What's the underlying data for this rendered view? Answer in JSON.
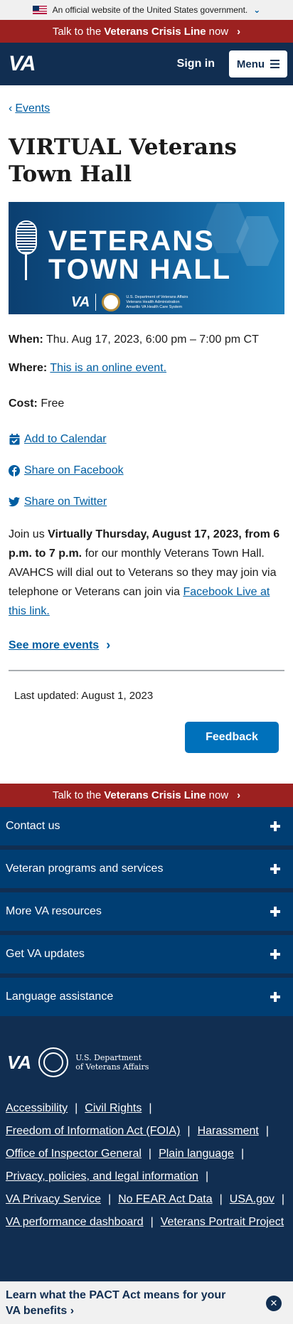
{
  "gov_banner": {
    "text": "An official website of the United States government."
  },
  "crisis": {
    "prefix": "Talk to the ",
    "bold": "Veterans Crisis Line",
    "suffix": " now"
  },
  "header": {
    "logo": "VA",
    "sign_in": "Sign in",
    "menu": "Menu"
  },
  "breadcrumb": {
    "label": "Events"
  },
  "page_title": "VIRTUAL Veterans Town Hall",
  "hero": {
    "line1": "VETERANS",
    "line2": "TOWN HALL",
    "va": "VA",
    "dept1": "U.S. Department of Veterans Affairs",
    "dept2": "Veterans Health Administration",
    "dept3": "Amarillo VA Health Care System"
  },
  "event": {
    "when_label": "When:",
    "when_value": "Thu. Aug 17, 2023, 6:00 pm – 7:00 pm CT",
    "where_label": "Where:",
    "where_value": "This is an online event.",
    "cost_label": "Cost:",
    "cost_value": "Free",
    "add_calendar": "Add to Calendar",
    "share_facebook": "Share on Facebook",
    "share_twitter": "Share on Twitter"
  },
  "description": {
    "p1": "Join us ",
    "bold": "Virtually Thursday, August 17, 2023, from 6 p.m. to 7 p.m.",
    "p2": " for our monthly Veterans Town Hall. AVAHCS will dial out to Veterans so they may join via telephone or Veterans can join via ",
    "link": "Facebook Live at this link."
  },
  "see_more": "See more events",
  "last_updated": "Last updated: August 1, 2023",
  "feedback": "Feedback",
  "footer": {
    "accordion": [
      {
        "label": "Contact us"
      },
      {
        "label": "Veteran programs and services"
      },
      {
        "label": "More VA resources"
      },
      {
        "label": "Get VA updates"
      },
      {
        "label": "Language assistance"
      }
    ],
    "logo_va": "VA",
    "dept_line1": "U.S. Department",
    "dept_line2": "of Veterans Affairs",
    "links": {
      "accessibility": "Accessibility",
      "civil_rights": "Civil Rights",
      "foia": "Freedom of Information Act (FOIA)",
      "harassment": "Harassment",
      "oig": "Office of Inspector General",
      "plain_language": "Plain language",
      "privacy": "Privacy, policies, and legal information",
      "privacy_service": "VA Privacy Service",
      "no_fear": "No FEAR Act Data",
      "usa_gov": "USA.gov",
      "dashboard": "VA performance dashboard",
      "portrait": "Veterans Portrait Project"
    }
  },
  "pact": {
    "text": "Learn what the PACT Act means for your VA benefits"
  },
  "colors": {
    "crisis": "#9c2120",
    "header": "#112e51",
    "link": "#005ea2",
    "feedback": "#0071bb",
    "accordion": "#003e73"
  }
}
